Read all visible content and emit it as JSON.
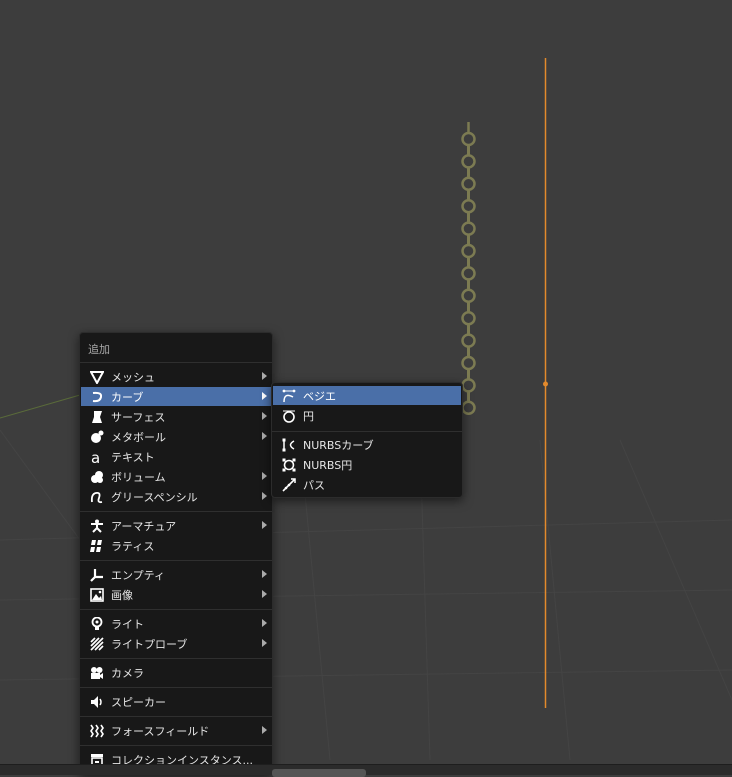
{
  "add_menu": {
    "title": "追加",
    "items": [
      {
        "label": "メッシュ",
        "icon": "mesh-icon",
        "submenu": true
      },
      {
        "label": "カーブ",
        "icon": "curve-icon",
        "submenu": true,
        "active": true
      },
      {
        "label": "サーフェス",
        "icon": "surface-icon",
        "submenu": true
      },
      {
        "label": "メタボール",
        "icon": "metaball-icon",
        "submenu": true
      },
      {
        "label": "テキスト",
        "icon": "text-icon",
        "submenu": false
      },
      {
        "label": "ボリューム",
        "icon": "volume-icon",
        "submenu": true
      },
      {
        "label": "グリースペンシル",
        "icon": "grease-pencil-icon",
        "submenu": true
      },
      {
        "label": "アーマチュア",
        "icon": "armature-icon",
        "submenu": true
      },
      {
        "label": "ラティス",
        "icon": "lattice-icon",
        "submenu": false
      },
      {
        "label": "エンプティ",
        "icon": "empty-icon",
        "submenu": true
      },
      {
        "label": "画像",
        "icon": "image-icon",
        "submenu": true
      },
      {
        "label": "ライト",
        "icon": "light-icon",
        "submenu": true
      },
      {
        "label": "ライトプローブ",
        "icon": "light-probe-icon",
        "submenu": true
      },
      {
        "label": "カメラ",
        "icon": "camera-icon",
        "submenu": false
      },
      {
        "label": "スピーカー",
        "icon": "speaker-icon",
        "submenu": false
      },
      {
        "label": "フォースフィールド",
        "icon": "force-field-icon",
        "submenu": true
      },
      {
        "label": "コレクションインスタンス...",
        "icon": "collection-instance-icon",
        "submenu": true
      }
    ]
  },
  "curve_submenu": {
    "items": [
      {
        "label": "ベジエ",
        "icon": "bezier-curve-icon",
        "active": true
      },
      {
        "label": "円",
        "icon": "bezier-circle-icon"
      },
      {
        "label": "NURBSカーブ",
        "icon": "nurbs-curve-icon"
      },
      {
        "label": "NURBS円",
        "icon": "nurbs-circle-icon"
      },
      {
        "label": "パス",
        "icon": "path-icon"
      }
    ]
  },
  "colors": {
    "viewport_bg": "#3d3d3d",
    "menu_bg": "#181818",
    "highlight": "#4a6fa8",
    "selected_orange": "#e38a2c",
    "chain_olive": "#8a8a5c"
  }
}
